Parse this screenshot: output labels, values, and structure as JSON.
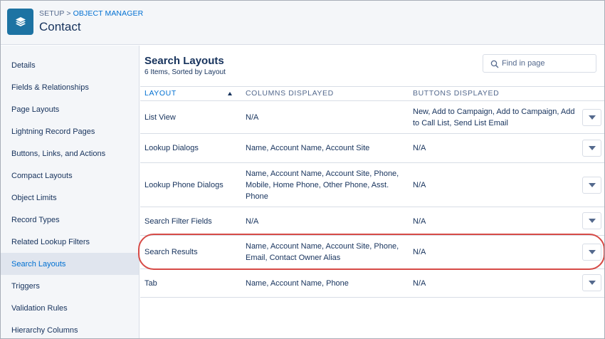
{
  "header": {
    "breadcrumb_root": "SETUP",
    "breadcrumb_sep": ">",
    "breadcrumb_link": "OBJECT MANAGER",
    "object_title": "Contact",
    "icon": "layers-icon"
  },
  "sidebar": {
    "items": [
      {
        "label": "Details",
        "active": false
      },
      {
        "label": "Fields & Relationships",
        "active": false
      },
      {
        "label": "Page Layouts",
        "active": false
      },
      {
        "label": "Lightning Record Pages",
        "active": false
      },
      {
        "label": "Buttons, Links, and Actions",
        "active": false
      },
      {
        "label": "Compact Layouts",
        "active": false
      },
      {
        "label": "Object Limits",
        "active": false
      },
      {
        "label": "Record Types",
        "active": false
      },
      {
        "label": "Related Lookup Filters",
        "active": false
      },
      {
        "label": "Search Layouts",
        "active": true
      },
      {
        "label": "Triggers",
        "active": false
      },
      {
        "label": "Validation Rules",
        "active": false
      },
      {
        "label": "Hierarchy Columns",
        "active": false
      }
    ]
  },
  "main": {
    "title": "Search Layouts",
    "subtitle": "6 Items, Sorted by Layout",
    "search": {
      "placeholder": "Find in page",
      "value": "",
      "icon": "search-icon"
    }
  },
  "table": {
    "columns": [
      "LAYOUT",
      "COLUMNS DISPLAYED",
      "BUTTONS DISPLAYED"
    ],
    "sort_icon": "sort-up-icon",
    "rows": [
      {
        "layout": "List View",
        "columns": "N/A",
        "buttons": "New, Add to Campaign, Add to Campaign, Add to Call List, Send List Email"
      },
      {
        "layout": "Lookup Dialogs",
        "columns": "Name, Account Name, Account Site",
        "buttons": "N/A"
      },
      {
        "layout": "Lookup Phone Dialogs",
        "columns": "Name, Account Name, Account Site, Phone, Mobile, Home Phone, Other Phone, Asst. Phone",
        "buttons": "N/A"
      },
      {
        "layout": "Search Filter Fields",
        "columns": "N/A",
        "buttons": "N/A"
      },
      {
        "layout": "Search Results",
        "columns": "Name, Account Name, Account Site, Phone, Email, Contact Owner Alias",
        "buttons": "N/A"
      },
      {
        "layout": "Tab",
        "columns": "Name, Account Name, Phone",
        "buttons": "N/A"
      }
    ],
    "row_action_icon": "chevron-down-icon"
  },
  "colors": {
    "accent": "#0070d2",
    "highlight": "#d64a46",
    "icon_bg": "#1d73a3"
  }
}
